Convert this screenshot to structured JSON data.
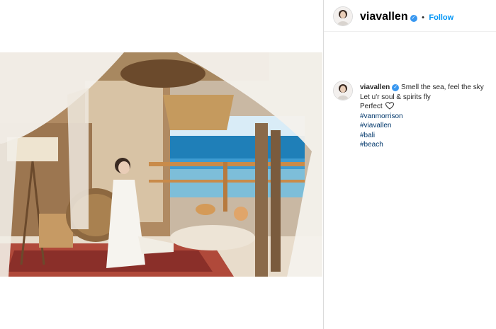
{
  "post": {
    "username": "viavallen",
    "verified_mark": "✓",
    "separator": "•",
    "follow_label": "Follow",
    "more_label": "·"
  },
  "caption": {
    "username": "viavallen",
    "line1": "Smell the sea, feel the sky",
    "line2": "Let u'r soul & spirits fly",
    "line3": "Perfect",
    "heart_icon": "heart-outline-icon",
    "hashtags": [
      "#vanmorrison",
      "#viavallen",
      "#bali",
      "#beach"
    ]
  },
  "colors": {
    "link": "#00376b",
    "follow": "#0095f6",
    "verified": "#3897f0"
  }
}
